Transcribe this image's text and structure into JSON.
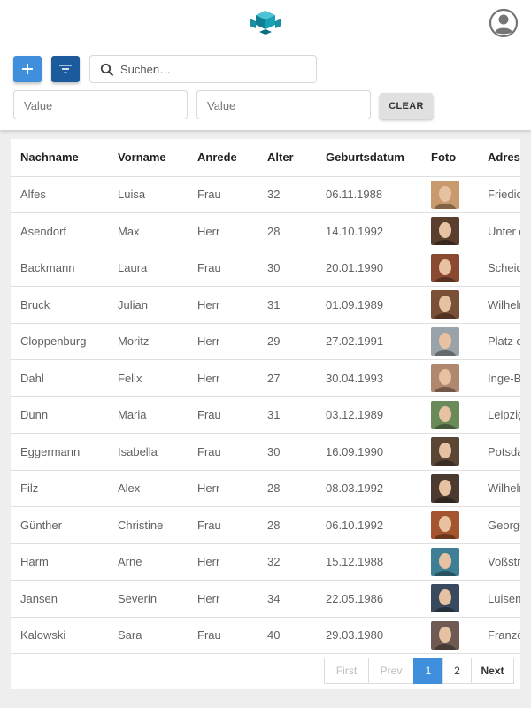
{
  "header": {
    "logo_icon": "cube-logo-icon",
    "account_icon": "account-circle-icon"
  },
  "toolbar": {
    "add_icon": "plus-icon",
    "filter_icon": "filter-list-icon",
    "search": {
      "placeholder": "Suchen…",
      "value": ""
    },
    "value1": {
      "placeholder": "Value",
      "value": ""
    },
    "value2": {
      "placeholder": "Value",
      "value": ""
    },
    "clear_label": "CLEAR"
  },
  "table": {
    "columns": [
      "Nachname",
      "Vorname",
      "Anrede",
      "Alter",
      "Geburtsdatum",
      "Foto",
      "Adresse"
    ],
    "rows": [
      {
        "nachname": "Alfes",
        "vorname": "Luisa",
        "anrede": "Frau",
        "alter": "32",
        "geburtsdatum": "06.11.1988",
        "foto_color": "#c99a6e",
        "adresse": "Friedic"
      },
      {
        "nachname": "Asendorf",
        "vorname": "Max",
        "anrede": "Herr",
        "alter": "28",
        "geburtsdatum": "14.10.1992",
        "foto_color": "#5a3e2e",
        "adresse": "Unter d"
      },
      {
        "nachname": "Backmann",
        "vorname": "Laura",
        "anrede": "Frau",
        "alter": "30",
        "geburtsdatum": "20.01.1990",
        "foto_color": "#8a4a32",
        "adresse": "Scheid"
      },
      {
        "nachname": "Bruck",
        "vorname": "Julian",
        "anrede": "Herr",
        "alter": "31",
        "geburtsdatum": "01.09.1989",
        "foto_color": "#7a5036",
        "adresse": "Wilheln"
      },
      {
        "nachname": "Cloppenburg",
        "vorname": "Moritz",
        "anrede": "Herr",
        "alter": "29",
        "geburtsdatum": "27.02.1991",
        "foto_color": "#9aa2aa",
        "adresse": "Platz d"
      },
      {
        "nachname": "Dahl",
        "vorname": "Felix",
        "anrede": "Herr",
        "alter": "27",
        "geburtsdatum": "30.04.1993",
        "foto_color": "#b08870",
        "adresse": "Inge-Bo"
      },
      {
        "nachname": "Dunn",
        "vorname": "Maria",
        "anrede": "Frau",
        "alter": "31",
        "geburtsdatum": "03.12.1989",
        "foto_color": "#6a8a5a",
        "adresse": "Leipzig"
      },
      {
        "nachname": "Eggermann",
        "vorname": "Isabella",
        "anrede": "Frau",
        "alter": "30",
        "geburtsdatum": "16.09.1990",
        "foto_color": "#5b4636",
        "adresse": "Potsda"
      },
      {
        "nachname": "Filz",
        "vorname": "Alex",
        "anrede": "Herr",
        "alter": "28",
        "geburtsdatum": "08.03.1992",
        "foto_color": "#4a3a30",
        "adresse": "Wilheln"
      },
      {
        "nachname": "Günther",
        "vorname": "Christine",
        "anrede": "Frau",
        "alter": "28",
        "geburtsdatum": "06.10.1992",
        "foto_color": "#a4552e",
        "adresse": "George"
      },
      {
        "nachname": "Harm",
        "vorname": "Arne",
        "anrede": "Herr",
        "alter": "32",
        "geburtsdatum": "15.12.1988",
        "foto_color": "#3f7f95",
        "adresse": "Voßstr"
      },
      {
        "nachname": "Jansen",
        "vorname": "Severin",
        "anrede": "Herr",
        "alter": "34",
        "geburtsdatum": "22.05.1986",
        "foto_color": "#3a4a5e",
        "adresse": "Luisen"
      },
      {
        "nachname": "Kalowski",
        "vorname": "Sara",
        "anrede": "Frau",
        "alter": "40",
        "geburtsdatum": "29.03.1980",
        "foto_color": "#6e5a52",
        "adresse": "Franzö"
      }
    ]
  },
  "pagination": {
    "first": "First",
    "prev": "Prev",
    "pages": [
      "1",
      "2"
    ],
    "active_page": "1",
    "next": "Next"
  },
  "colors": {
    "primary": "#3f8fdc",
    "primary_dark": "#1c5a9e",
    "logo": "#19a0b0"
  }
}
